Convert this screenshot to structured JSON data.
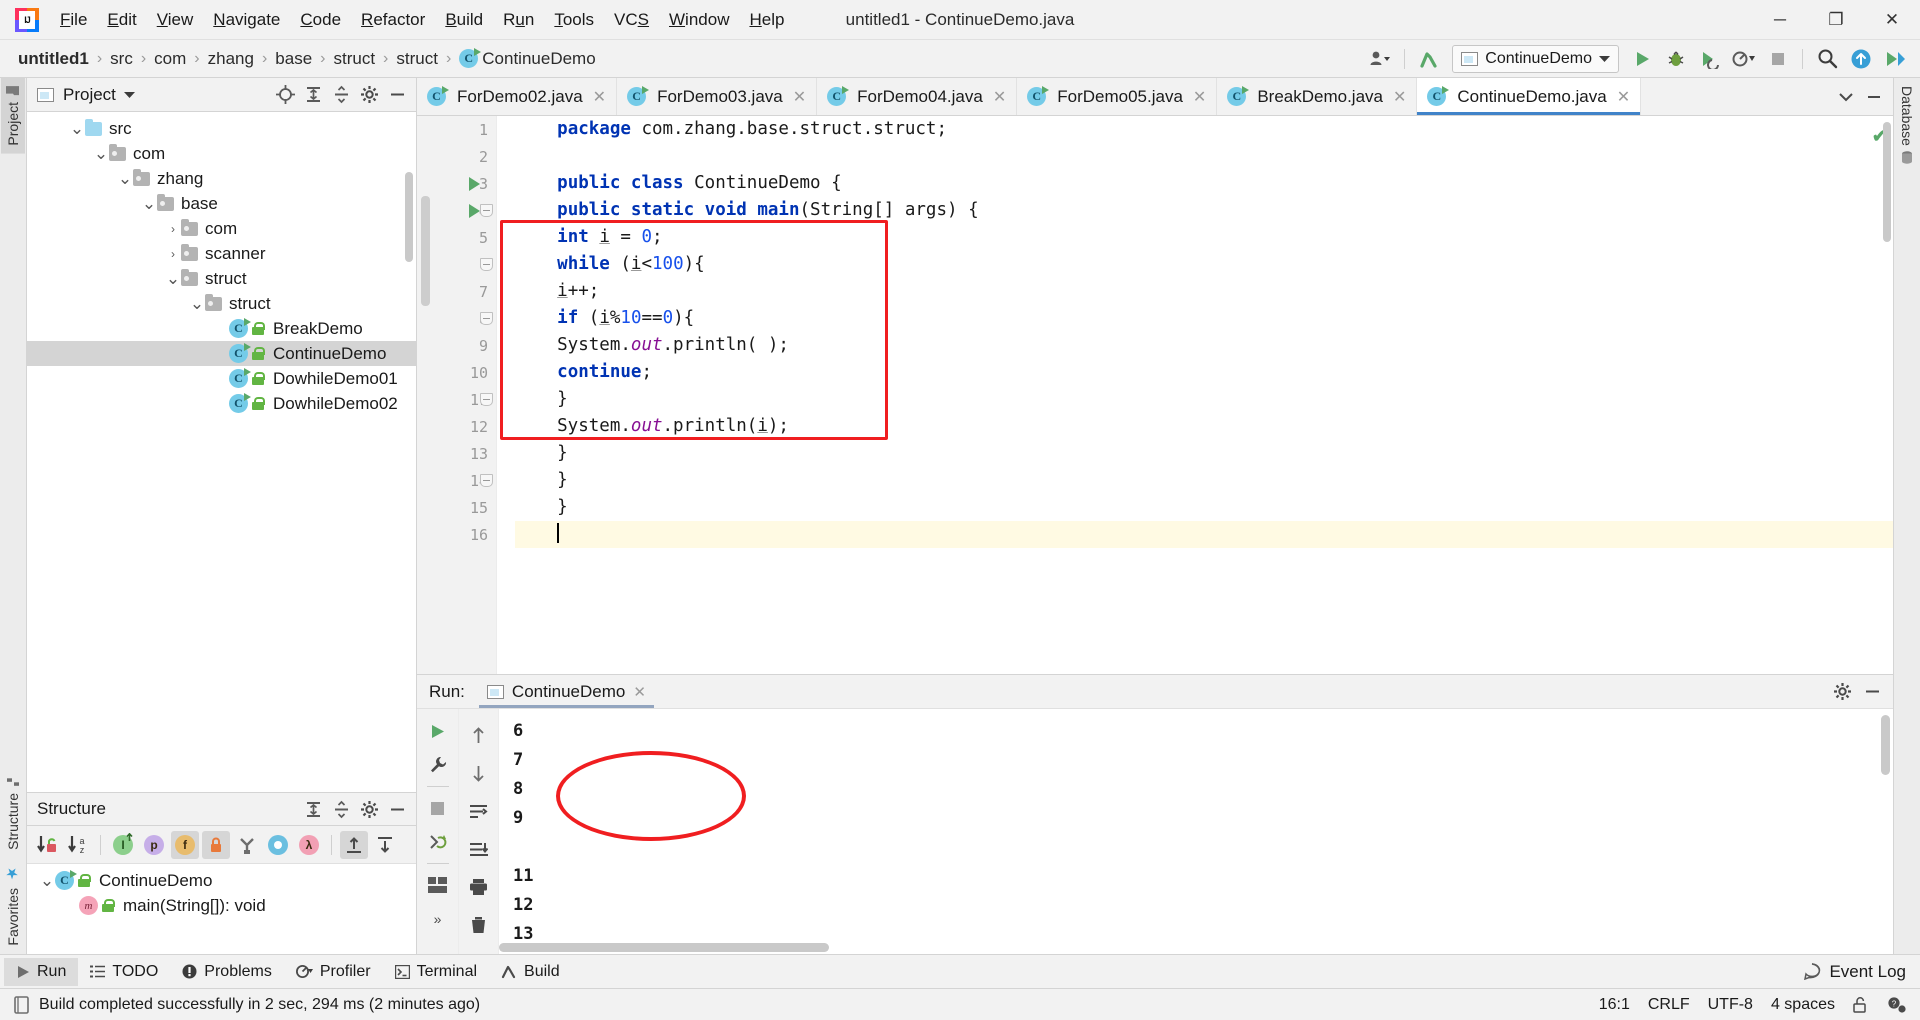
{
  "window": {
    "title": "untitled1 - ContinueDemo.java",
    "minimize": "─",
    "maximize": "❐",
    "close": "✕"
  },
  "menu": {
    "items": [
      "File",
      "Edit",
      "View",
      "Navigate",
      "Code",
      "Refactor",
      "Build",
      "Run",
      "Tools",
      "VCS",
      "Window",
      "Help"
    ]
  },
  "breadcrumb": {
    "separator": "›",
    "items": [
      "untitled1",
      "src",
      "com",
      "zhang",
      "base",
      "struct",
      "struct",
      "ContinueDemo"
    ]
  },
  "toolbar": {
    "run_config": "ContinueDemo",
    "profile_icon": "profile-icon",
    "update_icon": "update-project-icon",
    "run_icon": "run-icon",
    "debug_icon": "debug-icon",
    "coverage_icon": "run-with-coverage-icon",
    "profiler_icon": "profiler-icon",
    "stop_icon": "stop-icon",
    "search_icon": "search-everywhere-icon",
    "upload_icon": "upload-icon",
    "play_icon": "play-icon"
  },
  "left_strip": {
    "project_tab": "Project",
    "structure_tab": "Structure",
    "favorites_tab": "Favorites"
  },
  "right_strip": {
    "database_tab": "Database"
  },
  "project_panel": {
    "title": "Project",
    "tree": [
      {
        "label": "src",
        "indent": 1,
        "chevron": "⌄",
        "icon": "source-folder-icon",
        "selected": false
      },
      {
        "label": "com",
        "indent": 2,
        "chevron": "⌄",
        "icon": "folder-icon",
        "selected": false
      },
      {
        "label": "zhang",
        "indent": 3,
        "chevron": "⌄",
        "icon": "folder-icon",
        "selected": false
      },
      {
        "label": "base",
        "indent": 4,
        "chevron": "⌄",
        "icon": "folder-icon",
        "selected": false
      },
      {
        "label": "com",
        "indent": 5,
        "chevron": "›",
        "icon": "folder-icon",
        "selected": false
      },
      {
        "label": "scanner",
        "indent": 5,
        "chevron": "›",
        "icon": "folder-icon",
        "selected": false
      },
      {
        "label": "struct",
        "indent": 5,
        "chevron": "⌄",
        "icon": "folder-icon",
        "selected": false
      },
      {
        "label": "struct",
        "indent": 6,
        "chevron": "⌄",
        "icon": "folder-icon",
        "selected": false
      },
      {
        "label": "BreakDemo",
        "indent": 7,
        "chevron": "",
        "icon": "java-class-icon",
        "selected": false
      },
      {
        "label": "ContinueDemo",
        "indent": 7,
        "chevron": "",
        "icon": "java-class-icon",
        "selected": true
      },
      {
        "label": "DowhileDemo01",
        "indent": 7,
        "chevron": "",
        "icon": "java-class-icon",
        "selected": false
      },
      {
        "label": "DowhileDemo02",
        "indent": 7,
        "chevron": "",
        "icon": "java-class-icon",
        "selected": false
      }
    ]
  },
  "structure_panel": {
    "title": "Structure",
    "toolbar_icons": [
      {
        "name": "sort-by-visibility-icon",
        "glyph": "↓",
        "badge": "lock",
        "active": false
      },
      {
        "name": "sort-alphabetically-icon",
        "glyph": "↓",
        "badge": "az",
        "active": false
      },
      {
        "name": "show-inherited-icon",
        "glyph": "I",
        "color": "#7fc47f",
        "active": false
      },
      {
        "name": "show-properties-icon",
        "glyph": "p",
        "color": "#c6aee8",
        "active": false
      },
      {
        "name": "show-fields-icon",
        "glyph": "f",
        "color": "#e8bc6d",
        "active": true
      },
      {
        "name": "show-non-public-icon",
        "glyph": "■",
        "color": "#e8793a",
        "active": true
      },
      {
        "name": "group-methods-icon",
        "glyph": "Y",
        "color": "#6e6e6e",
        "active": false
      },
      {
        "name": "show-anonymous-icon",
        "glyph": "○",
        "color": "#6bbfe0",
        "active": false
      },
      {
        "name": "show-lambdas-icon",
        "glyph": "λ",
        "color": "#f2a0b4",
        "active": false
      },
      {
        "name": "expand-all-icon",
        "glyph": "⇱",
        "active": true
      },
      {
        "name": "collapse-all-icon",
        "glyph": "⇲",
        "active": false
      }
    ],
    "tree": [
      {
        "label": "ContinueDemo",
        "indent": 0,
        "chevron": "⌄",
        "icon": "java-class-icon"
      },
      {
        "label": "main(String[]): void",
        "indent": 1,
        "chevron": "",
        "icon": "method-icon"
      }
    ]
  },
  "editor": {
    "tabs": [
      {
        "label": "ForDemo02.java",
        "active": false
      },
      {
        "label": "ForDemo03.java",
        "active": false
      },
      {
        "label": "ForDemo04.java",
        "active": false
      },
      {
        "label": "ForDemo05.java",
        "active": false
      },
      {
        "label": "BreakDemo.java",
        "active": false
      },
      {
        "label": "ContinueDemo.java",
        "active": true
      }
    ],
    "close_glyph": "✕",
    "inspection_ok": "✔",
    "lines": [
      {
        "n": "1",
        "run": false,
        "fold": false,
        "current": false,
        "tokens": [
          {
            "t": "package ",
            "c": "kw"
          },
          {
            "t": "com.zhang.base.struct.struct;",
            "c": ""
          }
        ],
        "indent": 4
      },
      {
        "n": "2",
        "run": false,
        "fold": false,
        "current": false,
        "tokens": [],
        "indent": 0
      },
      {
        "n": "3",
        "run": true,
        "fold": false,
        "current": false,
        "tokens": [
          {
            "t": "public class ",
            "c": "kw"
          },
          {
            "t": "ContinueDemo {",
            "c": ""
          }
        ],
        "indent": 4
      },
      {
        "n": "4",
        "run": true,
        "fold": true,
        "current": false,
        "tokens": [
          {
            "t": "public static void ",
            "c": "kw"
          },
          {
            "t": "main",
            "c": "kw"
          },
          {
            "t": "(String[] args) {",
            "c": ""
          }
        ],
        "indent": 4
      },
      {
        "n": "5",
        "run": false,
        "fold": false,
        "current": false,
        "tokens": [
          {
            "t": "int ",
            "c": "kw"
          },
          {
            "t": "i",
            "c": "u"
          },
          {
            "t": " = ",
            "c": ""
          },
          {
            "t": "0",
            "c": "num"
          },
          {
            "t": ";",
            "c": ""
          }
        ],
        "indent": 4
      },
      {
        "n": "6",
        "run": false,
        "fold": true,
        "current": false,
        "tokens": [
          {
            "t": "while ",
            "c": "kw"
          },
          {
            "t": "(",
            "c": ""
          },
          {
            "t": "i",
            "c": "u"
          },
          {
            "t": "<",
            "c": ""
          },
          {
            "t": "100",
            "c": "num"
          },
          {
            "t": "){",
            "c": ""
          }
        ],
        "indent": 4
      },
      {
        "n": "7",
        "run": false,
        "fold": false,
        "current": false,
        "tokens": [
          {
            "t": "i",
            "c": "u"
          },
          {
            "t": "++;",
            "c": ""
          }
        ],
        "indent": 4
      },
      {
        "n": "8",
        "run": false,
        "fold": true,
        "current": false,
        "tokens": [
          {
            "t": "if ",
            "c": "kw"
          },
          {
            "t": "(",
            "c": ""
          },
          {
            "t": "i",
            "c": "u"
          },
          {
            "t": "%",
            "c": ""
          },
          {
            "t": "10",
            "c": "num"
          },
          {
            "t": "==",
            "c": ""
          },
          {
            "t": "0",
            "c": "num"
          },
          {
            "t": "){",
            "c": ""
          }
        ],
        "indent": 4
      },
      {
        "n": "9",
        "run": false,
        "fold": false,
        "current": false,
        "tokens": [
          {
            "t": "System.",
            "c": ""
          },
          {
            "t": "out",
            "c": "fld"
          },
          {
            "t": ".println( );",
            "c": ""
          }
        ],
        "indent": 4
      },
      {
        "n": "10",
        "run": false,
        "fold": false,
        "current": false,
        "tokens": [
          {
            "t": "continue",
            "c": "kw"
          },
          {
            "t": ";",
            "c": ""
          }
        ],
        "indent": 4
      },
      {
        "n": "11",
        "run": false,
        "fold": true,
        "current": false,
        "tokens": [
          {
            "t": "}",
            "c": ""
          }
        ],
        "indent": 4
      },
      {
        "n": "12",
        "run": false,
        "fold": false,
        "current": false,
        "tokens": [
          {
            "t": "System.",
            "c": ""
          },
          {
            "t": "out",
            "c": "fld"
          },
          {
            "t": ".println(",
            "c": ""
          },
          {
            "t": "i",
            "c": "u"
          },
          {
            "t": ");",
            "c": ""
          }
        ],
        "indent": 4
      },
      {
        "n": "13",
        "run": false,
        "fold": false,
        "current": false,
        "tokens": [
          {
            "t": "}",
            "c": ""
          }
        ],
        "indent": 4
      },
      {
        "n": "14",
        "run": false,
        "fold": true,
        "current": false,
        "tokens": [
          {
            "t": "}",
            "c": ""
          }
        ],
        "indent": 4
      },
      {
        "n": "15",
        "run": false,
        "fold": false,
        "current": false,
        "tokens": [
          {
            "t": "}",
            "c": ""
          }
        ],
        "indent": 4
      },
      {
        "n": "16",
        "run": false,
        "fold": false,
        "current": true,
        "tokens": [],
        "indent": 4
      }
    ]
  },
  "run_panel": {
    "label": "Run:",
    "tab": "ContinueDemo",
    "close_glyph": "✕",
    "console_lines": [
      "6",
      "7",
      "8",
      "9",
      "",
      "11",
      "12",
      "13"
    ],
    "toolbar_icons": [
      {
        "name": "rerun-icon",
        "glyph": "▶"
      },
      {
        "name": "edit-configuration-icon",
        "glyph": "🔧"
      },
      {
        "name": "stop-icon",
        "glyph": "■"
      },
      {
        "name": "rerun-failed-icon",
        "glyph": "↻"
      },
      {
        "name": "layout-icon",
        "glyph": "▤"
      },
      {
        "name": "settings-icon",
        "glyph": "⚙"
      }
    ],
    "toolbar2_icons": [
      {
        "name": "scroll-up-icon",
        "glyph": "↑"
      },
      {
        "name": "scroll-down-icon",
        "glyph": "↓"
      },
      {
        "name": "soft-wrap-icon",
        "glyph": "↩"
      },
      {
        "name": "scroll-to-end-icon",
        "glyph": "↧"
      },
      {
        "name": "print-icon",
        "glyph": "🖨"
      },
      {
        "name": "clear-all-icon",
        "glyph": "🗑"
      }
    ],
    "settings_icon": "gear-icon",
    "minimize_icon": "minimize-icon"
  },
  "bottom_bar": {
    "items": [
      {
        "label": "Run",
        "icon": "run-icon",
        "active": true
      },
      {
        "label": "TODO",
        "icon": "todo-icon",
        "active": false
      },
      {
        "label": "Problems",
        "icon": "problems-icon",
        "active": false
      },
      {
        "label": "Profiler",
        "icon": "profiler-icon",
        "active": false
      },
      {
        "label": "Terminal",
        "icon": "terminal-icon",
        "active": false
      },
      {
        "label": "Build",
        "icon": "build-icon",
        "active": false
      }
    ],
    "event_log": "Event Log"
  },
  "status_bar": {
    "message": "Build completed successfully in 2 sec, 294 ms (2 minutes ago)",
    "caret": "16:1",
    "line_separator": "CRLF",
    "encoding": "UTF-8",
    "indent": "4 spaces",
    "lock_icon": "unlock-icon",
    "inspection_icon": "inspection-icon"
  },
  "colors": {
    "accent": "#4083c9",
    "keyword": "#0033b3",
    "number": "#1750eb",
    "field": "#871094",
    "annotation_red": "#f01e20",
    "green": "#59a869"
  }
}
